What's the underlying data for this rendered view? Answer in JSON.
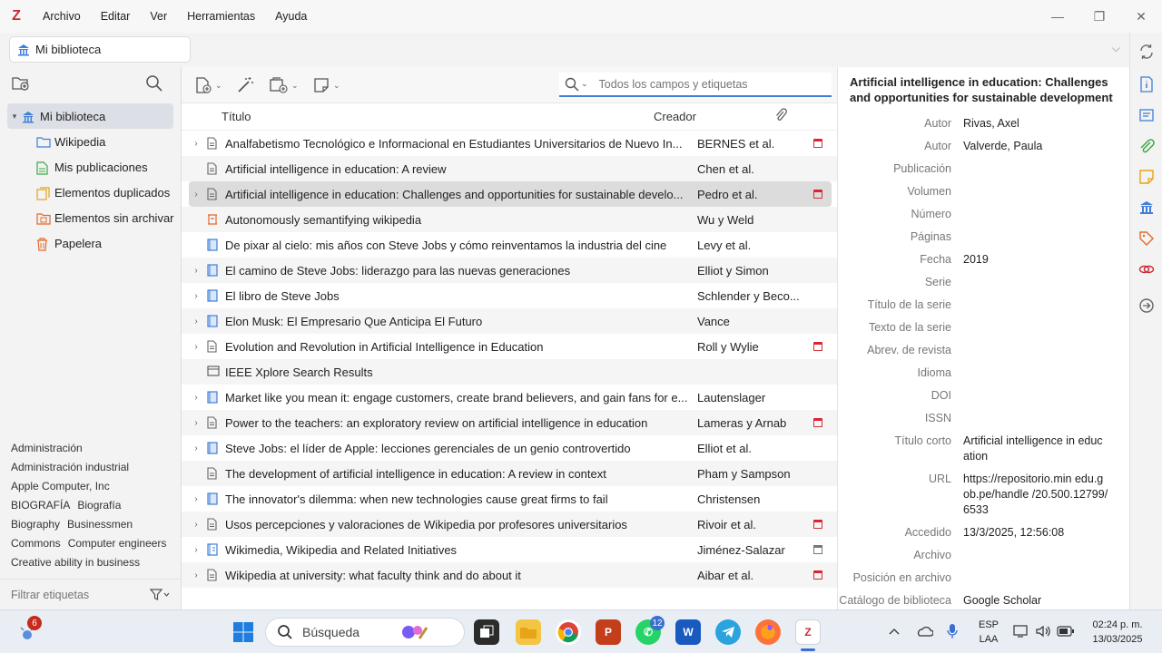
{
  "app": {
    "logo": "Z",
    "brand_color": "#cc2936",
    "accent_color": "#3f7fd8"
  },
  "menu": [
    "Archivo",
    "Editar",
    "Ver",
    "Herramientas",
    "Ayuda"
  ],
  "window_controls": {
    "minimize": "—",
    "maximize": "❐",
    "close": "✕"
  },
  "tab": {
    "label": "Mi biblioteca",
    "chevron": "⌵"
  },
  "collections": [
    {
      "label": "Mi biblioteca",
      "icon": "library-icon",
      "color": "#3f7fd8",
      "selected": true
    },
    {
      "label": "Wikipedia",
      "icon": "folder-icon",
      "color": "#3f7fd8"
    },
    {
      "label": "Mis publicaciones",
      "icon": "document-icon",
      "color": "#39a845"
    },
    {
      "label": "Elementos duplicados",
      "icon": "duplicate-icon",
      "color": "#e8a317"
    },
    {
      "label": "Elementos sin archivar",
      "icon": "unfiled-icon",
      "color": "#e06a2c"
    },
    {
      "label": "Papelera",
      "icon": "trash-icon",
      "color": "#e06a2c"
    }
  ],
  "tags": [
    "Administración",
    "Administración industrial",
    "Apple Computer, Inc",
    "BIOGRAFÍA",
    "Biografía",
    "Biography",
    "Businessmen",
    "Commons",
    "Computer engineers",
    "Creative ability in business"
  ],
  "tag_filter": {
    "placeholder": "Filtrar etiquetas"
  },
  "search": {
    "placeholder": "Todos los campos y etiquetas"
  },
  "columns": {
    "title": "Título",
    "creator": "Creador",
    "attachment_icon": "paperclip-icon"
  },
  "items": [
    {
      "title": "Analfabetismo Tecnológico e Informacional en Estudiantes Universitarios de Nuevo In...",
      "creator": "BERNES et al.",
      "type": "document",
      "twisty": true,
      "attachment": "pdf"
    },
    {
      "title": "Artificial intelligence in education: A review",
      "creator": "Chen et al.",
      "type": "document",
      "twisty": false,
      "attachment": ""
    },
    {
      "title": "Artificial intelligence in education: Challenges and opportunities for sustainable develo...",
      "creator": "Pedro et al.",
      "type": "document",
      "twisty": true,
      "attachment": "pdf",
      "selected": true
    },
    {
      "title": "Autonomously semantifying wikipedia",
      "creator": "Wu y Weld",
      "type": "conference",
      "twisty": false,
      "attachment": ""
    },
    {
      "title": "De pixar al cielo: mis años con Steve Jobs y cómo reinventamos la industria del cine",
      "creator": "Levy et al.",
      "type": "book",
      "twisty": false,
      "attachment": ""
    },
    {
      "title": "El camino de Steve Jobs: liderazgo para las nuevas generaciones",
      "creator": "Elliot y Simon",
      "type": "book",
      "twisty": true,
      "attachment": ""
    },
    {
      "title": "El libro de Steve Jobs",
      "creator": "Schlender y Beco...",
      "type": "book",
      "twisty": true,
      "attachment": ""
    },
    {
      "title": "Elon Musk: El Empresario Que Anticipa El Futuro",
      "creator": "Vance",
      "type": "book",
      "twisty": true,
      "attachment": ""
    },
    {
      "title": "Evolution and Revolution in Artificial Intelligence in Education",
      "creator": "Roll y Wylie",
      "type": "document",
      "twisty": true,
      "attachment": "pdf"
    },
    {
      "title": "IEEE Xplore Search Results",
      "creator": "",
      "type": "webpage",
      "twisty": false,
      "attachment": ""
    },
    {
      "title": "Market like you mean it: engage customers, create brand believers, and gain fans for e...",
      "creator": "Lautenslager",
      "type": "book",
      "twisty": true,
      "attachment": ""
    },
    {
      "title": "Power to the teachers: an exploratory review on artificial intelligence in education",
      "creator": "Lameras y Arnab",
      "type": "document",
      "twisty": true,
      "attachment": "pdf"
    },
    {
      "title": "Steve Jobs: el líder de Apple: lecciones gerenciales de un genio controvertido",
      "creator": "Elliot et al.",
      "type": "book",
      "twisty": true,
      "attachment": ""
    },
    {
      "title": "The development of artificial intelligence in education: A review in context",
      "creator": "Pham y Sampson",
      "type": "document",
      "twisty": false,
      "attachment": ""
    },
    {
      "title": "The innovator's dilemma: when new technologies cause great firms to fail",
      "creator": "Christensen",
      "type": "book",
      "twisty": true,
      "attachment": ""
    },
    {
      "title": "Usos percepciones y valoraciones de Wikipedia por profesores universitarios",
      "creator": "Rivoir et al.",
      "type": "document",
      "twisty": true,
      "attachment": "pdf"
    },
    {
      "title": "Wikimedia, Wikipedia and Related Initiatives",
      "creator": "Jiménez-Salazar",
      "type": "booksection",
      "twisty": true,
      "attachment": "snapshot"
    },
    {
      "title": "Wikipedia at university: what faculty think and do about it",
      "creator": "Aibar et al.",
      "type": "document",
      "twisty": true,
      "attachment": "pdf"
    }
  ],
  "detail": {
    "title": "Artificial intelligence in education: Challenges and opportunities for sustainable development",
    "fields": [
      {
        "label": "Autor",
        "value": "Rivas, Axel"
      },
      {
        "label": "Autor",
        "value": "Valverde, Paula"
      },
      {
        "label": "Publicación",
        "value": ""
      },
      {
        "label": "Volumen",
        "value": ""
      },
      {
        "label": "Número",
        "value": ""
      },
      {
        "label": "Páginas",
        "value": ""
      },
      {
        "label": "Fecha",
        "value": "2019"
      },
      {
        "label": "Serie",
        "value": ""
      },
      {
        "label": "Título de la serie",
        "value": ""
      },
      {
        "label": "Texto de la serie",
        "value": ""
      },
      {
        "label": "Abrev. de revista",
        "value": ""
      },
      {
        "label": "Idioma",
        "value": ""
      },
      {
        "label": "DOI",
        "value": ""
      },
      {
        "label": "ISSN",
        "value": ""
      },
      {
        "label": "Título corto",
        "value": "Artificial intelligence in education"
      },
      {
        "label": "URL",
        "value": "https://repositorio.min edu.gob.pe/handle /20.500.12799/6533"
      },
      {
        "label": "Accedido",
        "value": "13/3/2025, 12:56:08"
      },
      {
        "label": "Archivo",
        "value": ""
      },
      {
        "label": "Posición en archivo",
        "value": ""
      },
      {
        "label": "Catálogo de biblioteca",
        "value": "Google Scholar"
      }
    ]
  },
  "taskbar": {
    "search_label": "Búsqueda",
    "widget_badge": "6",
    "whatsapp_badge": "12",
    "lang_top": "ESP",
    "lang_bottom": "LAA",
    "time": "02:24 p. m.",
    "date": "13/03/2025"
  }
}
